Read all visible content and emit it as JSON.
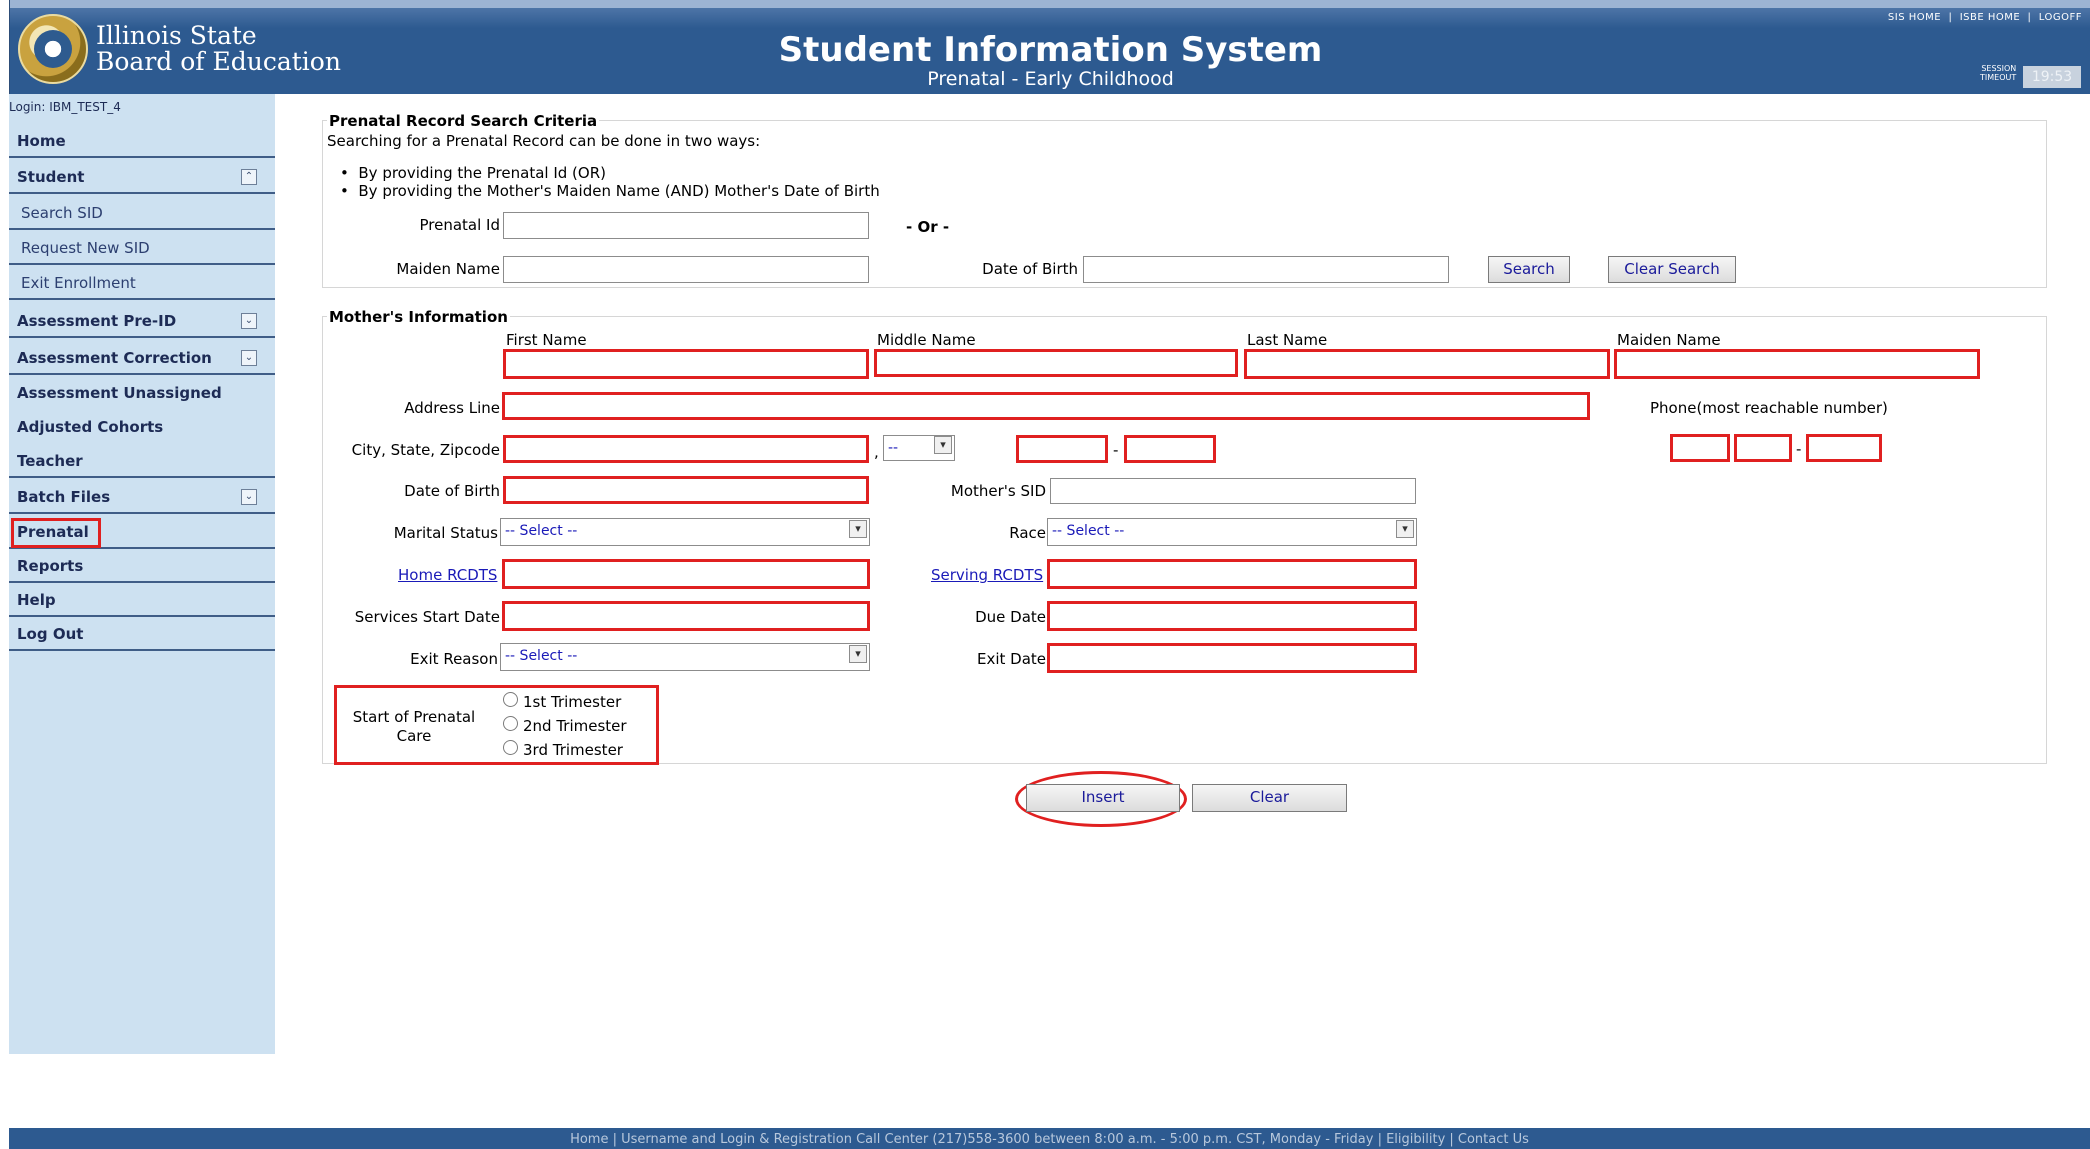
{
  "header": {
    "org_line1": "Illinois State",
    "org_line2": "Board of Education",
    "app_title": "Student Information System",
    "app_subtitle": "Prenatal - Early Childhood",
    "links": [
      "SIS HOME",
      "ISBE HOME",
      "LOGOFF"
    ],
    "session_label_1": "SESSION",
    "session_label_2": "TIMEOUT",
    "session_timer": "19:53"
  },
  "sidebar": {
    "login": "Login: IBM_TEST_4",
    "items": [
      {
        "label": "Home"
      },
      {
        "label": "Student"
      },
      {
        "label": "Search SID"
      },
      {
        "label": "Request New SID"
      },
      {
        "label": "Exit Enrollment"
      },
      {
        "label": "Assessment Pre-ID"
      },
      {
        "label": "Assessment Correction"
      },
      {
        "label": "Assessment Unassigned"
      },
      {
        "label": "Adjusted Cohorts"
      },
      {
        "label": "Teacher"
      },
      {
        "label": "Batch Files"
      },
      {
        "label": "Prenatal"
      },
      {
        "label": "Reports"
      },
      {
        "label": "Help"
      },
      {
        "label": "Log Out"
      }
    ]
  },
  "search": {
    "legend": "Prenatal Record Search Criteria",
    "intro": "Searching for a Prenatal Record can be done in two ways:",
    "bullet1": "By providing the Prenatal Id (OR)",
    "bullet2": "By providing the Mother's Maiden Name (AND) Mother's Date of Birth",
    "prenatal_id_label": "Prenatal Id",
    "or_text": "- Or -",
    "maiden_name_label": "Maiden Name",
    "dob_label": "Date of Birth",
    "search_button": "Search",
    "clear_search_button": "Clear Search"
  },
  "mother": {
    "legend": "Mother's Information",
    "first_name": "First Name",
    "middle_name": "Middle Name",
    "last_name": "Last Name",
    "maiden_name": "Maiden Name",
    "address_line": "Address Line",
    "phone": "Phone(most reachable number)",
    "city_state_zip": "City, State, Zipcode",
    "comma": ",",
    "state_default": "--",
    "dash": "-",
    "dob": "Date of Birth",
    "mothers_sid": "Mother's SID",
    "marital_status": "Marital Status",
    "marital_select": "-- Select --",
    "race": "Race",
    "race_select": "-- Select --",
    "home_rcdts": "Home RCDTS",
    "serving_rcdts": "Serving RCDTS",
    "services_start_date": "Services Start Date",
    "due_date": "Due Date",
    "exit_reason": "Exit Reason",
    "exit_reason_select": "-- Select --",
    "exit_date": "Exit Date",
    "prenatal_care_label_1": "Start of Prenatal",
    "prenatal_care_label_2": "Care",
    "trimesters": [
      "1st Trimester",
      "2nd Trimester",
      "3rd Trimester"
    ]
  },
  "actions": {
    "insert": "Insert",
    "clear": "Clear"
  },
  "footer": {
    "text": "Home  |  Username and Login & Registration  Call Center (217)558-3600  between 8:00 a.m. - 5:00 p.m. CST, Monday - Friday  |  Eligibility  |  Contact Us"
  },
  "colors": {
    "header_blue": "#2d5a90",
    "sidebar_bg": "#cde1f1",
    "required_border": "#e02020",
    "link_blue": "#1a1ab8"
  }
}
